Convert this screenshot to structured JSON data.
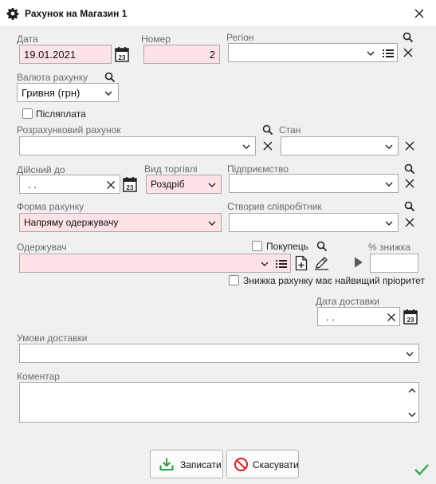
{
  "window": {
    "title": "Рахунок на Магазин 1"
  },
  "fields": {
    "date": {
      "label": "Дата",
      "value": "19.01.2021"
    },
    "number": {
      "label": "Номер",
      "value": "2"
    },
    "region": {
      "label": "Регіон",
      "value": ""
    },
    "currency": {
      "label": "Валюта рахунку",
      "value": "Гривня (грн)"
    },
    "postpay": {
      "label": "Післяплата",
      "checked": false
    },
    "settlement_account": {
      "label": "Розрахунковий рахунок",
      "value": ""
    },
    "state": {
      "label": "Стан",
      "value": ""
    },
    "valid_until": {
      "label": "Дійсний до",
      "value": ". ."
    },
    "trade_type": {
      "label": "Вид торгівлі",
      "value": "Роздріб"
    },
    "enterprise": {
      "label": "Підприємство",
      "value": ""
    },
    "invoice_form": {
      "label": "Форма рахунку",
      "value": "Напряму одержувачу"
    },
    "created_by": {
      "label": "Створив співробітник",
      "value": ""
    },
    "recipient": {
      "label": "Одержувач",
      "value": ""
    },
    "buyer": {
      "label": "Покупець",
      "checked": false
    },
    "discount": {
      "label": "% знижка",
      "value": ""
    },
    "discount_priority": {
      "label": "Знижка рахунку має найвищий пріоритет",
      "checked": false
    },
    "delivery_date": {
      "label": "Дата доставки",
      "value": ". ."
    },
    "delivery_terms": {
      "label": "Умови доставки",
      "value": ""
    },
    "comment": {
      "label": "Коментар",
      "value": ""
    }
  },
  "calendar_day": "23",
  "buttons": {
    "save": "Записати",
    "cancel": "Скасувати"
  },
  "colors": {
    "required_bg": "#fde3e6",
    "save_icon": "#2e9e46",
    "cancel_icon": "#d0202a",
    "ok_check": "#3aa84a"
  }
}
